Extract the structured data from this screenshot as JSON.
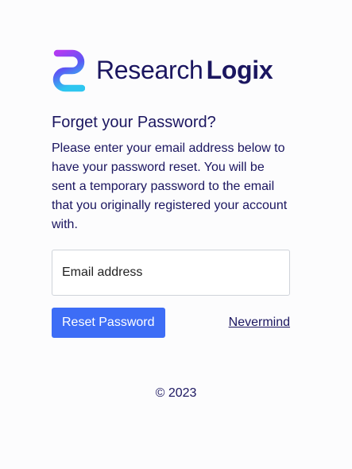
{
  "brand": {
    "name_light": "Research",
    "name_bold": "Logix",
    "logo_icon": "research-logix-logo-mark",
    "colors": {
      "navy": "#1b1660",
      "gradient_start": "#b23af2",
      "gradient_mid": "#5b57f4",
      "gradient_end": "#2ec6f0"
    }
  },
  "form": {
    "heading": "Forget your Password?",
    "description": "Please enter your email address below to have your password reset. You will be sent a temporary password to the email that you originally registered your account with.",
    "email_placeholder": "Email address",
    "email_value": "",
    "reset_button_label": "Reset Password",
    "nevermind_label": "Nevermind",
    "accent_color": "#3d6df6"
  },
  "footer": {
    "copyright": "© 2023"
  }
}
